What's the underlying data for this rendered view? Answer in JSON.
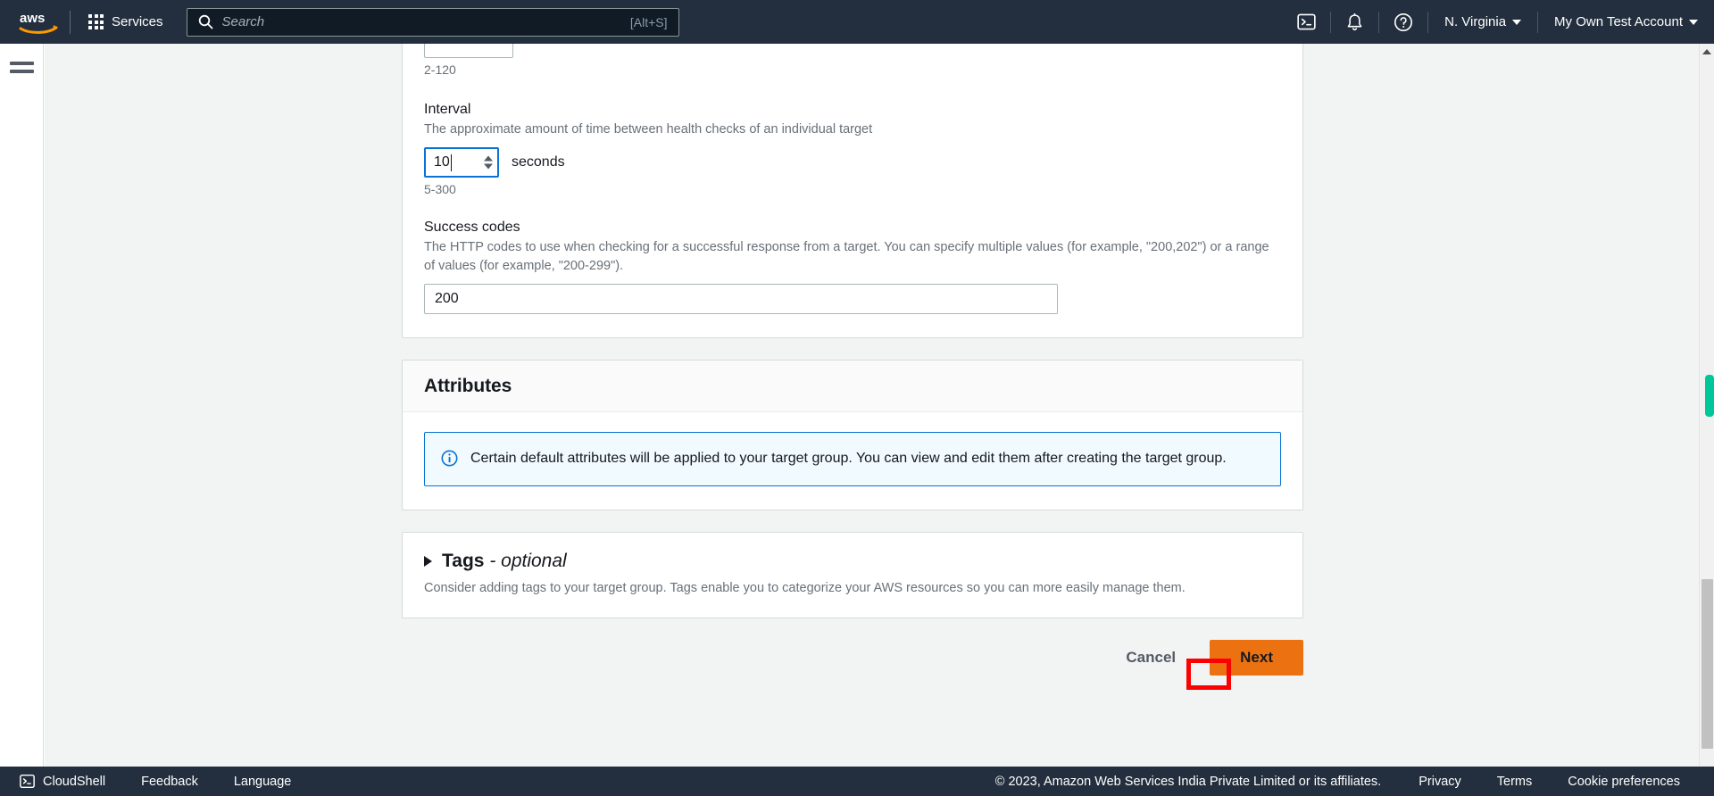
{
  "topnav": {
    "logo_alt": "aws",
    "services_label": "Services",
    "search": {
      "placeholder": "Search",
      "value": "",
      "shortcut": "[Alt+S]"
    },
    "cloudshell_icon": "cloudshell-icon",
    "notifications_icon": "bell-icon",
    "help_icon": "question-circle-icon",
    "region_label": "N. Virginia",
    "account_label": "My Own Test Account"
  },
  "left_rail": {
    "menu_icon": "hamburger-menu-icon"
  },
  "form": {
    "partial_field": {
      "hint": "2-120"
    },
    "interval": {
      "label": "Interval",
      "description": "The approximate amount of time between health checks of an individual target",
      "value": "10",
      "unit": "seconds",
      "hint": "5-300"
    },
    "success_codes": {
      "label": "Success codes",
      "description": "The HTTP codes to use when checking for a successful response from a target. You can specify multiple values (for example, \"200,202\") or a range of values (for example, \"200-299\").",
      "value": "200"
    }
  },
  "attributes": {
    "title": "Attributes",
    "info_icon": "info-circle-icon",
    "alert_text": "Certain default attributes will be applied to your target group. You can view and edit them after creating the target group."
  },
  "tags": {
    "expand_icon": "triangle-right-icon",
    "title": "Tags",
    "optional_suffix": "- optional",
    "description": "Consider adding tags to your target group. Tags enable you to categorize your AWS resources so you can more easily manage them."
  },
  "actions": {
    "cancel_label": "Cancel",
    "next_label": "Next"
  },
  "scrollbar": {
    "up_arrow_icon": "triangle-up-icon"
  },
  "bottombar": {
    "cloudshell_icon": "cloudshell-icon",
    "cloudshell_label": "CloudShell",
    "feedback_label": "Feedback",
    "language_label": "Language",
    "copyright": "© 2023, Amazon Web Services India Private Limited or its affiliates.",
    "privacy_label": "Privacy",
    "terms_label": "Terms",
    "cookie_label": "Cookie preferences"
  },
  "colors": {
    "nav_bg": "#232f3e",
    "accent_orange": "#ec7211",
    "focus_blue": "#0972d3",
    "alert_bg": "#f1faff",
    "annotation_red": "#ff0000",
    "scroll_thumb_green": "#00c79a"
  }
}
